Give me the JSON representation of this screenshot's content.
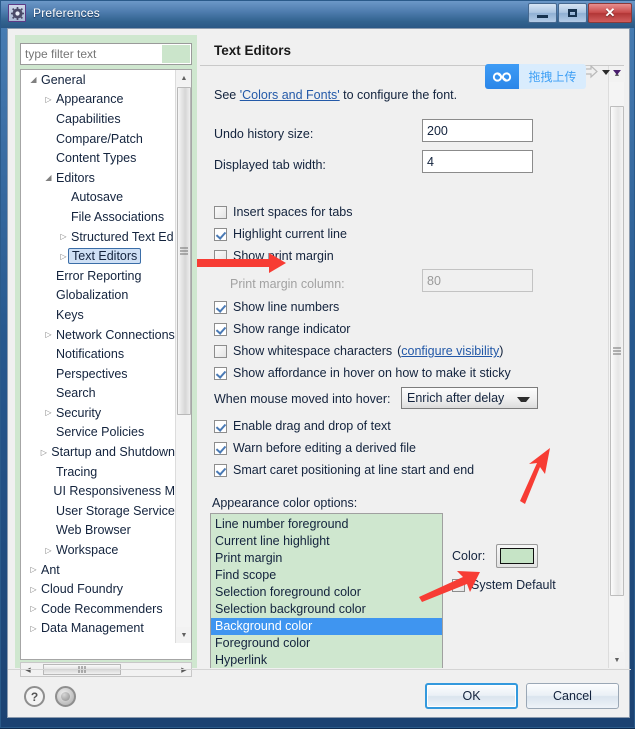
{
  "window": {
    "title": "Preferences",
    "app_icon": "gear-icon",
    "buttons": {
      "minimize": "minimize-icon",
      "maximize": "maximize-icon",
      "close": "✕"
    }
  },
  "sidebar": {
    "filter": {
      "placeholder": "type filter text",
      "value": ""
    },
    "items": [
      {
        "label": "General",
        "indent": 0,
        "twisty": "expanded"
      },
      {
        "label": "Appearance",
        "indent": 1,
        "twisty": "collapsed"
      },
      {
        "label": "Capabilities",
        "indent": 1,
        "twisty": "none"
      },
      {
        "label": "Compare/Patch",
        "indent": 1,
        "twisty": "none"
      },
      {
        "label": "Content Types",
        "indent": 1,
        "twisty": "none"
      },
      {
        "label": "Editors",
        "indent": 1,
        "twisty": "expanded"
      },
      {
        "label": "Autosave",
        "indent": 2,
        "twisty": "none"
      },
      {
        "label": "File Associations",
        "indent": 2,
        "twisty": "none"
      },
      {
        "label": "Structured Text Ed",
        "indent": 2,
        "twisty": "collapsed"
      },
      {
        "label": "Text Editors",
        "indent": 2,
        "twisty": "collapsed",
        "selected": true
      },
      {
        "label": "Error Reporting",
        "indent": 1,
        "twisty": "none"
      },
      {
        "label": "Globalization",
        "indent": 1,
        "twisty": "none"
      },
      {
        "label": "Keys",
        "indent": 1,
        "twisty": "none"
      },
      {
        "label": "Network Connections",
        "indent": 1,
        "twisty": "collapsed"
      },
      {
        "label": "Notifications",
        "indent": 1,
        "twisty": "none"
      },
      {
        "label": "Perspectives",
        "indent": 1,
        "twisty": "none"
      },
      {
        "label": "Search",
        "indent": 1,
        "twisty": "none"
      },
      {
        "label": "Security",
        "indent": 1,
        "twisty": "collapsed"
      },
      {
        "label": "Service Policies",
        "indent": 1,
        "twisty": "none"
      },
      {
        "label": "Startup and Shutdown",
        "indent": 1,
        "twisty": "collapsed"
      },
      {
        "label": "Tracing",
        "indent": 1,
        "twisty": "none"
      },
      {
        "label": "UI Responsiveness M",
        "indent": 1,
        "twisty": "none"
      },
      {
        "label": "User Storage Service",
        "indent": 1,
        "twisty": "none"
      },
      {
        "label": "Web Browser",
        "indent": 1,
        "twisty": "none"
      },
      {
        "label": "Workspace",
        "indent": 1,
        "twisty": "collapsed"
      },
      {
        "label": "Ant",
        "indent": 0,
        "twisty": "collapsed"
      },
      {
        "label": "Cloud Foundry",
        "indent": 0,
        "twisty": "collapsed"
      },
      {
        "label": "Code Recommenders",
        "indent": 0,
        "twisty": "collapsed"
      },
      {
        "label": "Data Management",
        "indent": 0,
        "twisty": "collapsed"
      }
    ]
  },
  "page": {
    "title": "Text Editors",
    "intro_prefix": "See ",
    "intro_link": "'Colors and Fonts'",
    "intro_suffix": " to configure the font.",
    "fields": [
      {
        "label": "Undo history size:",
        "value": "200",
        "disabled": false
      },
      {
        "label": "Displayed tab width:",
        "value": "4",
        "disabled": false
      }
    ],
    "print_margin_label": "Print margin column:",
    "print_margin_value": "80",
    "checkboxes": [
      {
        "label": "Insert spaces for tabs",
        "checked": false
      },
      {
        "label": "Highlight current line",
        "checked": true
      },
      {
        "label": "Show print margin",
        "checked": false
      },
      {
        "label": "Show line numbers",
        "checked": true
      },
      {
        "label": "Show range indicator",
        "checked": true
      },
      {
        "label": "Show whitespace characters",
        "checked": false,
        "link": "configure visibility"
      },
      {
        "label": "Show affordance in hover on how to make it sticky",
        "checked": true
      },
      {
        "label": "Enable drag and drop of text",
        "checked": true
      },
      {
        "label": "Warn before editing a derived file",
        "checked": true
      },
      {
        "label": "Smart caret positioning at line start and end",
        "checked": true
      }
    ],
    "hover_label": "When mouse moved into hover:",
    "hover_value": "Enrich after delay",
    "appearance_label": "Appearance color options:",
    "color_options": [
      "Line number foreground",
      "Current line highlight",
      "Print margin",
      "Find scope",
      "Selection foreground color",
      "Selection background color",
      "Background color",
      "Foreground color",
      "Hyperlink"
    ],
    "color_selected": "Background color",
    "color_field_label": "Color:",
    "color_swatch_value": "#c6e4c6",
    "system_default_label": "System Default",
    "system_default_checked": false
  },
  "footer": {
    "help_icon": "?",
    "restore_icon": "restore-defaults-icon",
    "ok_label": "OK",
    "cancel_label": "Cancel"
  },
  "overlay": {
    "baidu_label": "拖拽上传",
    "baidu_icon": "baidu-cloud-icon"
  },
  "colors": {
    "theme_green": "#cfe7cf",
    "selection_blue": "#3f95f0",
    "link_blue": "#2359a8",
    "annotation_red": "#f73c34"
  }
}
